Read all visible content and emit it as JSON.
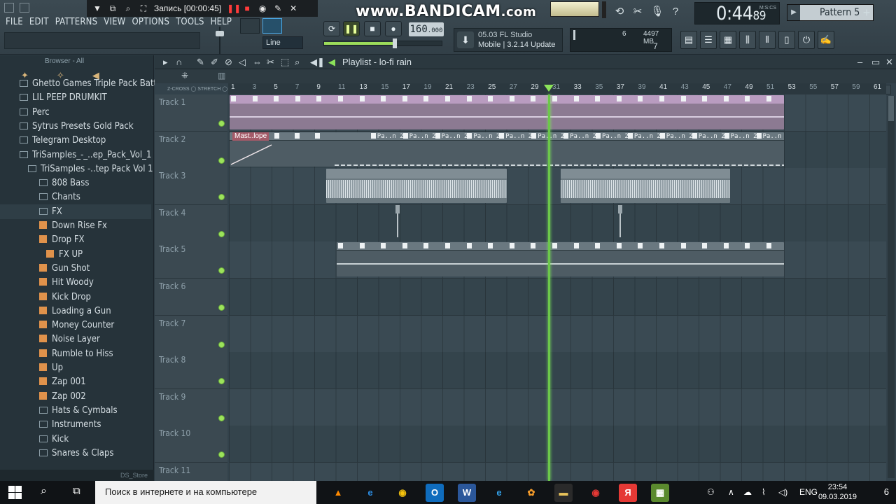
{
  "recorder": {
    "label": "Запись [00:00:45]",
    "watermark": "www.BANDICAM",
    "watermark_domain": ".com"
  },
  "menu": [
    "FILE",
    "EDIT",
    "PATTERNS",
    "VIEW",
    "OPTIONS",
    "TOOLS",
    "HELP"
  ],
  "snap": {
    "mode": "Line"
  },
  "transport": {
    "bpm": "160",
    "bpm_decimal": ".000",
    "position_fraction": 0.6
  },
  "news": {
    "line1": "05.03  FL Studio",
    "line2": "Mobile | 3.2.14 Update"
  },
  "monitor": {
    "voices": "6",
    "ram": "4497 MB",
    "cpu": "7"
  },
  "time": {
    "value": "0:44",
    "sub": "89",
    "unit": "M:S:CS"
  },
  "pattern": {
    "label": "Pattern 5"
  },
  "browser": {
    "header": "Browser - All",
    "items": [
      {
        "label": "Ghetto Games Triple Pack Battle",
        "type": "folder",
        "indent": 1
      },
      {
        "label": "LIL PEEP DRUMKIT",
        "type": "folder",
        "indent": 1
      },
      {
        "label": "Perc",
        "type": "folder",
        "indent": 1
      },
      {
        "label": "Sytrus Presets Gold Pack",
        "type": "folder",
        "indent": 1
      },
      {
        "label": "Telegram Desktop",
        "type": "folder",
        "indent": 1
      },
      {
        "label": "TriSamples_-_..ep_Pack_Vol_1",
        "type": "folder",
        "indent": 1
      },
      {
        "label": "TriSamples -..tep Pack Vol 1",
        "type": "folder",
        "indent": 2
      },
      {
        "label": "808 Bass",
        "type": "folder",
        "indent": 3
      },
      {
        "label": "Chants",
        "type": "folder",
        "indent": 3
      },
      {
        "label": "FX",
        "type": "folder",
        "indent": 3,
        "selected": true
      },
      {
        "label": "Down Rise Fx",
        "type": "fx",
        "indent": 3
      },
      {
        "label": "Drop FX",
        "type": "fx",
        "indent": 3
      },
      {
        "label": "FX UP",
        "type": "fx",
        "indent": 4
      },
      {
        "label": "Gun Shot",
        "type": "fx",
        "indent": 3
      },
      {
        "label": "Hit Woody",
        "type": "fx",
        "indent": 3
      },
      {
        "label": "Kick Drop",
        "type": "fx",
        "indent": 3
      },
      {
        "label": "Loading a Gun",
        "type": "fx",
        "indent": 3
      },
      {
        "label": "Money Counter",
        "type": "fx",
        "indent": 3
      },
      {
        "label": "Noise Layer",
        "type": "fx",
        "indent": 3
      },
      {
        "label": "Rumble to Hiss",
        "type": "fx",
        "indent": 3
      },
      {
        "label": "Up",
        "type": "fx",
        "indent": 3
      },
      {
        "label": "Zap 001",
        "type": "fx",
        "indent": 3
      },
      {
        "label": "Zap 002",
        "type": "fx",
        "indent": 3
      },
      {
        "label": "Hats & Cymbals",
        "type": "folder",
        "indent": 3
      },
      {
        "label": "Instruments",
        "type": "folder",
        "indent": 3
      },
      {
        "label": "Kick",
        "type": "folder",
        "indent": 3
      },
      {
        "label": "Snares & Claps",
        "type": "folder",
        "indent": 3
      }
    ],
    "footer": "DS_Store"
  },
  "playlist": {
    "title": "Playlist - lo-fi rain",
    "zcross": "Z-CROSS",
    "stretch": "STRETCH",
    "ruler": [
      "1",
      "3",
      "5",
      "7",
      "9",
      "11",
      "13",
      "15",
      "17",
      "19",
      "21",
      "23",
      "25",
      "27",
      "29",
      "31",
      "33",
      "35",
      "37",
      "39",
      "41",
      "43",
      "45",
      "47",
      "49",
      "51",
      "53",
      "55",
      "57",
      "59",
      "61"
    ],
    "automation_label": "Mast..lope",
    "pattern_label": "Pa..n 2",
    "tracks": [
      "Track 1",
      "Track 2",
      "Track 3",
      "Track 4",
      "Track 5",
      "Track 6",
      "Track 7",
      "Track 8",
      "Track 9",
      "Track 10",
      "Track 11"
    ]
  },
  "taskbar": {
    "search_placeholder": "Поиск в интернете и на компьютере",
    "lang": "ENG",
    "time": "23:54",
    "date": "09.03.2019",
    "notifications": "6"
  }
}
